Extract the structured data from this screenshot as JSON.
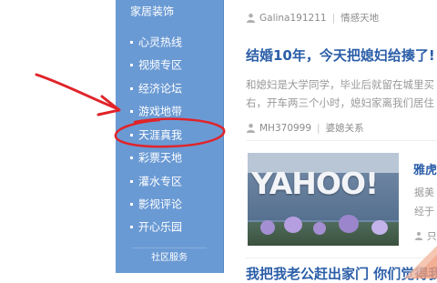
{
  "sidebar": {
    "top_item": "家居装饰",
    "items": [
      "心灵热线",
      "视频专区",
      "经济论坛",
      "游戏地带",
      "天涯真我",
      "彩票天地",
      "灌水专区",
      "影视评论",
      "开心乐园"
    ],
    "section_label": "社区服务"
  },
  "article1": {
    "author": "Galina191211",
    "category": "情感天地",
    "title": "结婚10年，今天把媳妇给揍了!",
    "excerpt_lines": [
      "和媳妇是大学同学，毕业后就留在城里买",
      "右，开车两三个小时，媳妇家离我们居住"
    ],
    "bottom_author": "MH370999",
    "bottom_category": "婆媳关系"
  },
  "article2": {
    "thumb_logo": "YAHOO!",
    "title_fragment": "雅虎",
    "excerpt_fragments": [
      "据美",
      "经于"
    ],
    "meta_fragment": "只"
  },
  "article3": {
    "title_fragment": "我把我老公赶出家门 你们觉得我做对了吗"
  },
  "colors": {
    "sidebar_bg": "#6a9ad4",
    "headline": "#2b5ea8",
    "annotation": "#e0242a"
  }
}
